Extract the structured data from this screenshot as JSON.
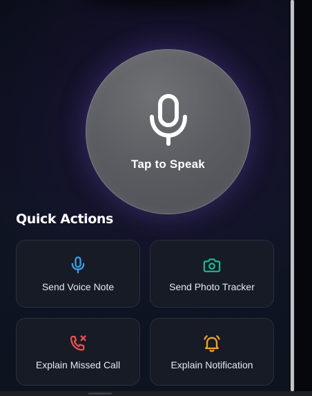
{
  "speak": {
    "label": "Tap to Speak",
    "icon": "microphone-icon"
  },
  "quick_actions": {
    "title": "Quick Actions",
    "items": [
      {
        "label": "Send Voice Note",
        "icon": "microphone-icon",
        "color": "#3aa0e8"
      },
      {
        "label": "Send Photo Tracker",
        "icon": "camera-icon",
        "color": "#21b38a"
      },
      {
        "label": "Explain Missed Call",
        "icon": "missed-call-icon",
        "color": "#e8514e"
      },
      {
        "label": "Explain Notification",
        "icon": "bell-icon",
        "color": "#f2a51f"
      }
    ]
  },
  "colors": {
    "background": "#0d111e",
    "card": "#161b26",
    "card_border": "#2a303d",
    "speak_circle": "#5c5e63",
    "text": "#ffffff"
  }
}
